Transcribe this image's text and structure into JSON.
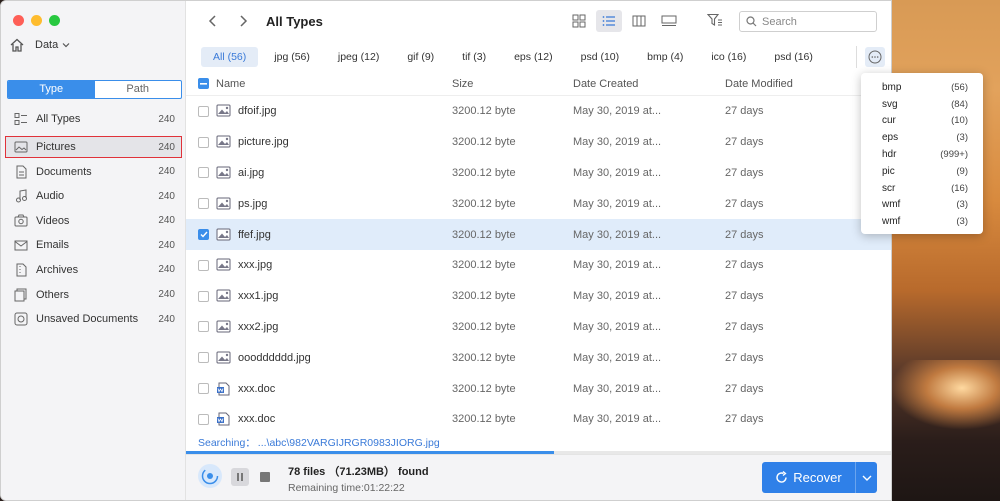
{
  "sidebar": {
    "home_label": "Data",
    "segment": {
      "type_label": "Type",
      "path_label": "Path"
    },
    "items": [
      {
        "label": "All Types",
        "count": "240",
        "icon": "list-icon"
      },
      {
        "label": "Pictures",
        "count": "240",
        "icon": "picture-icon"
      },
      {
        "label": "Documents",
        "count": "240",
        "icon": "document-icon"
      },
      {
        "label": "Audio",
        "count": "240",
        "icon": "music-note-icon"
      },
      {
        "label": "Videos",
        "count": "240",
        "icon": "video-icon"
      },
      {
        "label": "Emails",
        "count": "240",
        "icon": "mail-icon"
      },
      {
        "label": "Archives",
        "count": "240",
        "icon": "archive-icon"
      },
      {
        "label": "Others",
        "count": "240",
        "icon": "others-icon"
      },
      {
        "label": "Unsaved Documents",
        "count": "240",
        "icon": "unsaved-document-icon"
      }
    ]
  },
  "toolbar": {
    "title": "All Types",
    "search_placeholder": "Search"
  },
  "chips": [
    {
      "label": "All  (56)",
      "active": true
    },
    {
      "label": "jpg  (56)"
    },
    {
      "label": "jpeg  (12)"
    },
    {
      "label": "gif  (9)"
    },
    {
      "label": "tif  (3)"
    },
    {
      "label": "eps  (12)"
    },
    {
      "label": "psd  (10)"
    },
    {
      "label": "bmp  (4)"
    },
    {
      "label": "ico  (16)"
    },
    {
      "label": "psd  (16)"
    }
  ],
  "table": {
    "headers": {
      "name": "Name",
      "size": "Size",
      "date_created": "Date Created",
      "date_modified": "Date Modified"
    },
    "rows": [
      {
        "name": "dfoif.jpg",
        "size": "3200.12 byte",
        "created": "May 30, 2019 at...",
        "modified": "27 days",
        "type": "image",
        "checked": false
      },
      {
        "name": "picture.jpg",
        "size": "3200.12 byte",
        "created": "May 30, 2019 at...",
        "modified": "27 days",
        "type": "image",
        "checked": false
      },
      {
        "name": "ai.jpg",
        "size": "3200.12 byte",
        "created": "May 30, 2019 at...",
        "modified": "27 days",
        "type": "image",
        "checked": false
      },
      {
        "name": "ps.jpg",
        "size": "3200.12 byte",
        "created": "May 30, 2019 at...",
        "modified": "27 days",
        "type": "image",
        "checked": false
      },
      {
        "name": "ffef.jpg",
        "size": "3200.12 byte",
        "created": "May 30, 2019 at...",
        "modified": "27 days",
        "type": "image",
        "checked": true
      },
      {
        "name": "xxx.jpg",
        "size": "3200.12 byte",
        "created": "May 30, 2019 at...",
        "modified": "27 days",
        "type": "image",
        "checked": false
      },
      {
        "name": "xxx1.jpg",
        "size": "3200.12 byte",
        "created": "May 30, 2019 at...",
        "modified": "27 days",
        "type": "image",
        "checked": false
      },
      {
        "name": "xxx2.jpg",
        "size": "3200.12 byte",
        "created": "May 30, 2019 at...",
        "modified": "27 days",
        "type": "image",
        "checked": false
      },
      {
        "name": "ooodddddd.jpg",
        "size": "3200.12 byte",
        "created": "May 30, 2019 at...",
        "modified": "27 days",
        "type": "image",
        "checked": false
      },
      {
        "name": "xxx.doc",
        "size": "3200.12 byte",
        "created": "May 30, 2019 at...",
        "modified": "27 days",
        "type": "doc",
        "checked": false
      },
      {
        "name": "xxx.doc",
        "size": "3200.12 byte",
        "created": "May 30, 2019 at...",
        "modified": "27 days",
        "type": "doc",
        "checked": false
      }
    ]
  },
  "status": {
    "searching_label": "Searching：",
    "searching_path": "...\\abc\\982VARGIJRGR0983JIORG.jpg",
    "progress": 0.52
  },
  "footer": {
    "found": "78 files （71.23MB） found",
    "remaining": "Remaining time:01:22:22",
    "recover_label": "Recover"
  },
  "dropdown": [
    {
      "label": "bmp",
      "count": "(56)"
    },
    {
      "label": "svg",
      "count": "(84)"
    },
    {
      "label": "cur",
      "count": "(10)"
    },
    {
      "label": "eps",
      "count": "(3)"
    },
    {
      "label": "hdr",
      "count": "(999+)"
    },
    {
      "label": "pic",
      "count": "(9)"
    },
    {
      "label": "scr",
      "count": "(16)"
    },
    {
      "label": "wmf",
      "count": "(3)"
    },
    {
      "label": "wmf",
      "count": "(3)"
    }
  ],
  "colors": {
    "accent": "#2f80e8",
    "selection_border": "#e0323a",
    "selected_row": "#e0ecfa"
  }
}
